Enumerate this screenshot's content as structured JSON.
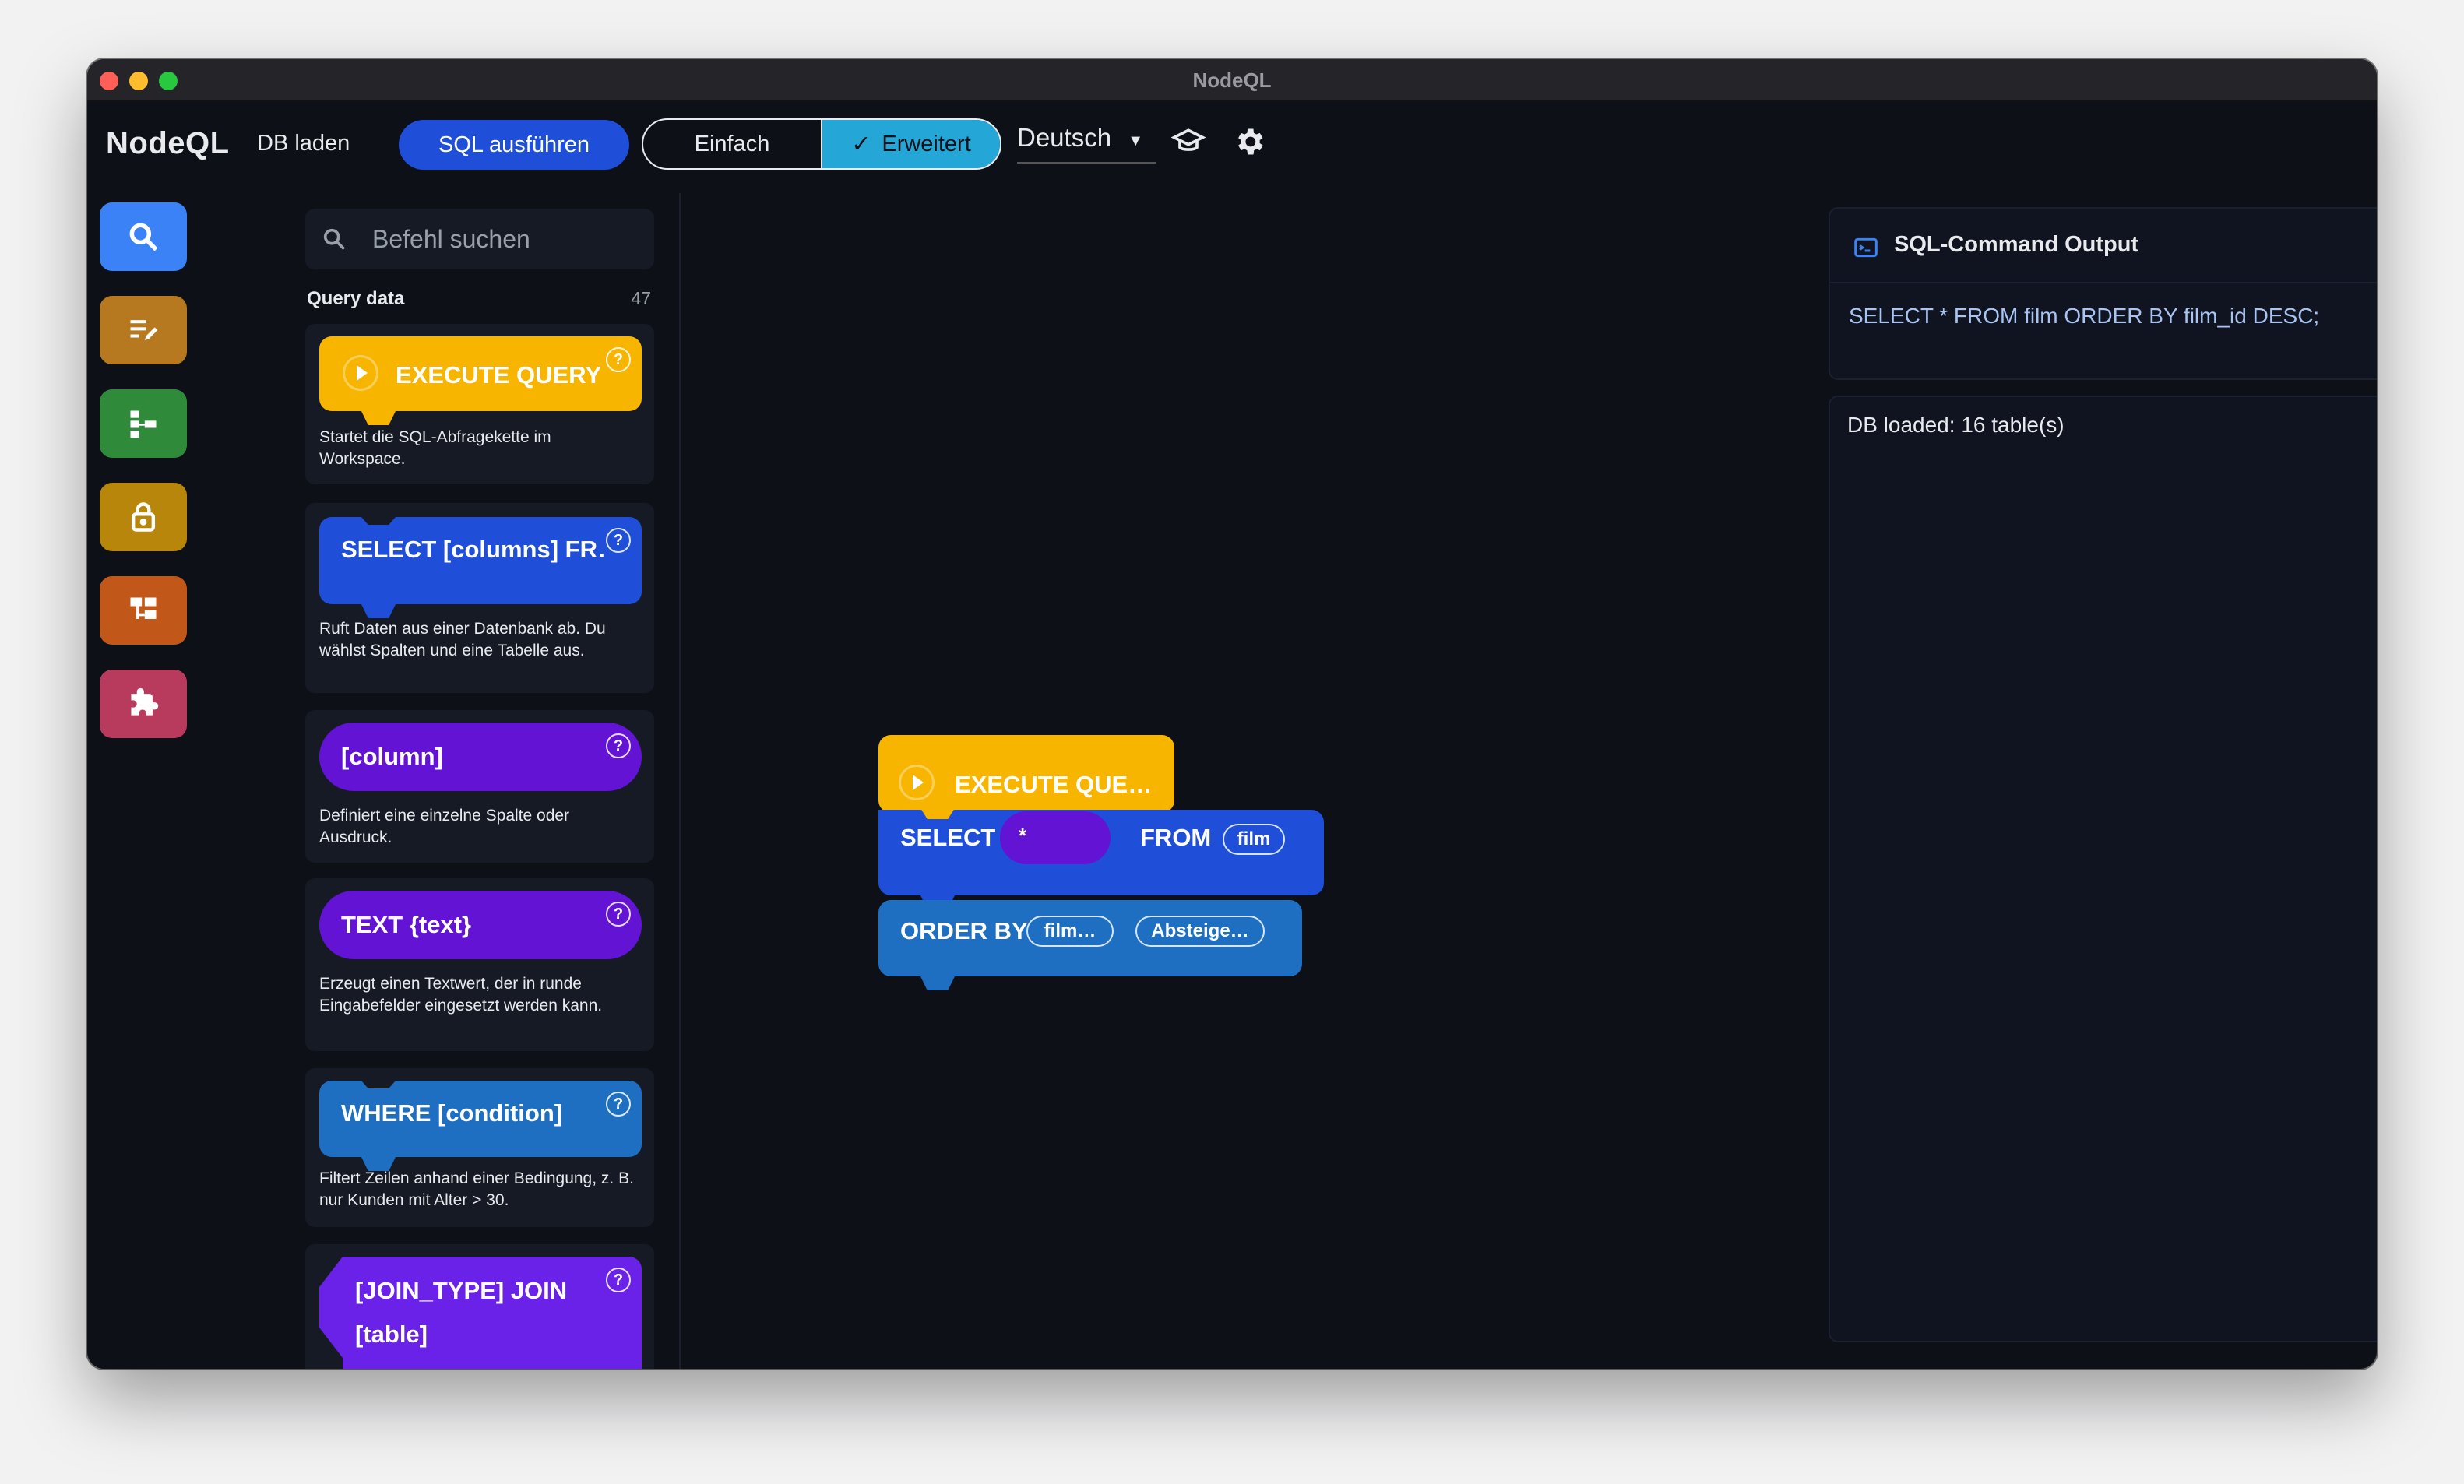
{
  "window": {
    "title": "NodeQL"
  },
  "toolbar": {
    "brand": "NodeQL",
    "load_db": "DB laden",
    "run_sql": "SQL ausführen",
    "mode_simple": "Einfach",
    "mode_advanced": "Erweitert",
    "mode_selected": "Erweitert",
    "language": "Deutsch"
  },
  "rail": {
    "items": [
      {
        "name": "search",
        "icon": "search-icon",
        "color": "#3b82f6"
      },
      {
        "name": "edit",
        "icon": "edit-list-icon",
        "color": "#b7791f"
      },
      {
        "name": "structure",
        "icon": "tree-structure-icon",
        "color": "#2f8a3a"
      },
      {
        "name": "lock",
        "icon": "lock-icon",
        "color": "#b8860b"
      },
      {
        "name": "hierarchy",
        "icon": "hierarchy-icon",
        "color": "#c2571a"
      },
      {
        "name": "extensions",
        "icon": "puzzle-icon",
        "color": "#b83a5c"
      }
    ]
  },
  "library": {
    "search_placeholder": "Befehl suchen",
    "section_title": "Query data",
    "count": "47",
    "cards": [
      {
        "label": "EXECUTE QUERY",
        "color": "#f8b500",
        "description": "Startet die SQL-Abfragekette im Workspace."
      },
      {
        "label": "SELECT [columns] FR…",
        "color": "#1f4fd9",
        "description": "Ruft Daten aus einer Datenbank ab. Du wählst Spalten und eine Tabelle aus."
      },
      {
        "label": "[column]",
        "color": "#6313d4",
        "description": "Definiert eine einzelne Spalte oder Ausdruck."
      },
      {
        "label": "TEXT {text}",
        "color": "#6313d4",
        "description": "Erzeugt einen Textwert, der in runde Eingabefelder eingesetzt werden kann."
      },
      {
        "label": "WHERE [condition]",
        "color": "#1e6fc2",
        "description": "Filtert Zeilen anhand einer Bedingung, z. B. nur Kunden mit Alter > 30."
      },
      {
        "label_line1": "[JOIN_TYPE] JOIN",
        "label_line2": "[table]",
        "color": "#6a22e8"
      }
    ],
    "help_glyph": "?"
  },
  "workspace": {
    "execute_label": "EXECUTE QUE…",
    "select_label": "SELECT",
    "select_value": "*",
    "from_label": "FROM",
    "from_value": "film",
    "orderby_label": "ORDER BY",
    "orderby_column": "film…",
    "orderby_direction": "Absteige…"
  },
  "output": {
    "title": "SQL-Command Output",
    "sql": "SELECT * FROM film ORDER BY film_id DESC;",
    "status": "DB loaded: 16 table(s)"
  }
}
